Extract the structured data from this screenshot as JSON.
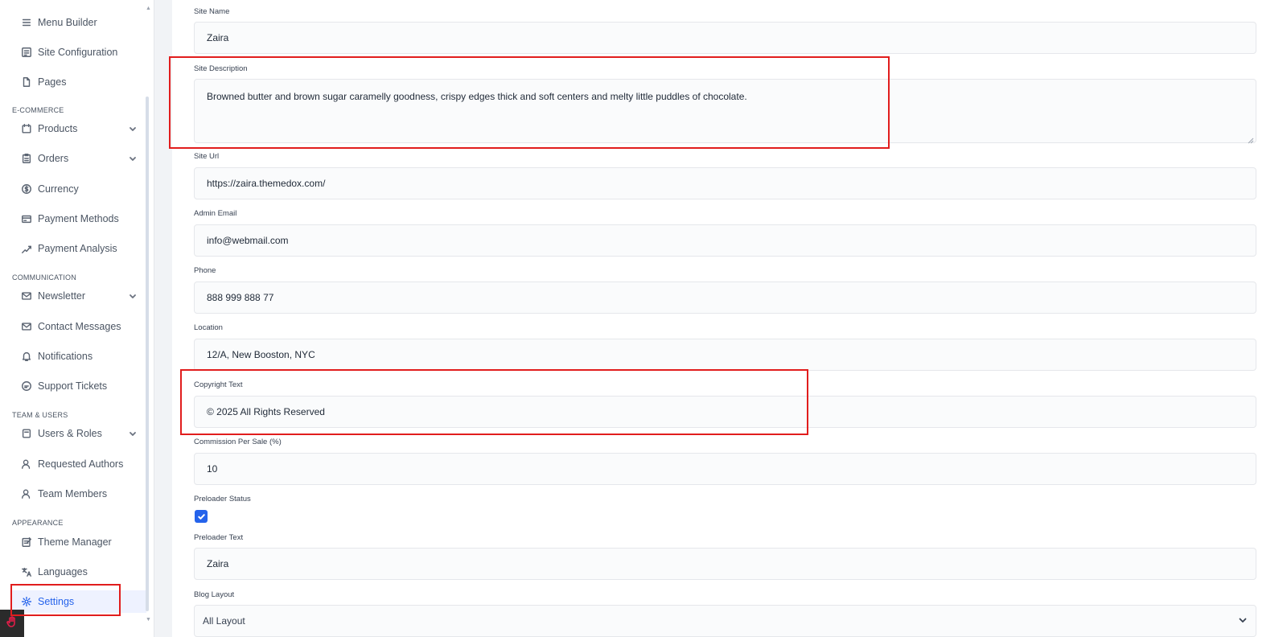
{
  "sidebar": {
    "items_top": [
      {
        "label": "Menu Builder",
        "icon": "menu-icon"
      },
      {
        "label": "Site Configuration",
        "icon": "list-icon"
      },
      {
        "label": "Pages",
        "icon": "file-icon"
      }
    ],
    "sections": {
      "ecommerce": "E-COMMERCE",
      "communication": "COMMUNICATION",
      "team_users": "TEAM & USERS",
      "appearance": "APPEARANCE"
    },
    "ecommerce_items": [
      {
        "label": "Products",
        "icon": "box-icon",
        "has_children": true
      },
      {
        "label": "Orders",
        "icon": "clipboard-icon",
        "has_children": true
      },
      {
        "label": "Currency",
        "icon": "dollar-icon"
      },
      {
        "label": "Payment Methods",
        "icon": "credit-card-icon"
      },
      {
        "label": "Payment Analysis",
        "icon": "chart-icon"
      }
    ],
    "communication_items": [
      {
        "label": "Newsletter",
        "icon": "mail-icon",
        "has_children": true
      },
      {
        "label": "Contact Messages",
        "icon": "mail-icon"
      },
      {
        "label": "Notifications",
        "icon": "bell-icon"
      },
      {
        "label": "Support Tickets",
        "icon": "chat-icon"
      }
    ],
    "team_items": [
      {
        "label": "Users & Roles",
        "icon": "users-icon",
        "has_children": true
      },
      {
        "label": "Requested Authors",
        "icon": "user-icon"
      },
      {
        "label": "Team Members",
        "icon": "user-icon"
      }
    ],
    "appearance_items": [
      {
        "label": "Theme Manager",
        "icon": "palette-icon"
      },
      {
        "label": "Languages",
        "icon": "translate-icon"
      },
      {
        "label": "Settings",
        "icon": "gear-icon",
        "active": true
      }
    ]
  },
  "form": {
    "site_name": {
      "label": "Site Name",
      "value": "Zaira"
    },
    "site_description": {
      "label": "Site Description",
      "value": "Browned butter and brown sugar caramelly goodness, crispy edges thick and soft centers and melty little puddles of chocolate."
    },
    "site_url": {
      "label": "Site Url",
      "value": "https://zaira.themedox.com/"
    },
    "admin_email": {
      "label": "Admin Email",
      "value": "info@webmail.com"
    },
    "phone": {
      "label": "Phone",
      "value": "888 999 888 77"
    },
    "location": {
      "label": "Location",
      "value": "12/A, New Booston, NYC"
    },
    "copyright": {
      "label": "Copyright Text",
      "value": "© 2025 All Rights Reserved"
    },
    "commission": {
      "label": "Commission Per Sale (%)",
      "value": "10"
    },
    "preloader_status": {
      "label": "Preloader Status",
      "checked": true
    },
    "preloader_text": {
      "label": "Preloader Text",
      "value": "Zaira"
    },
    "blog_layout": {
      "label": "Blog Layout",
      "value": "All Layout"
    }
  },
  "colors": {
    "accent": "#2563eb",
    "highlight": "#e11d1d"
  }
}
